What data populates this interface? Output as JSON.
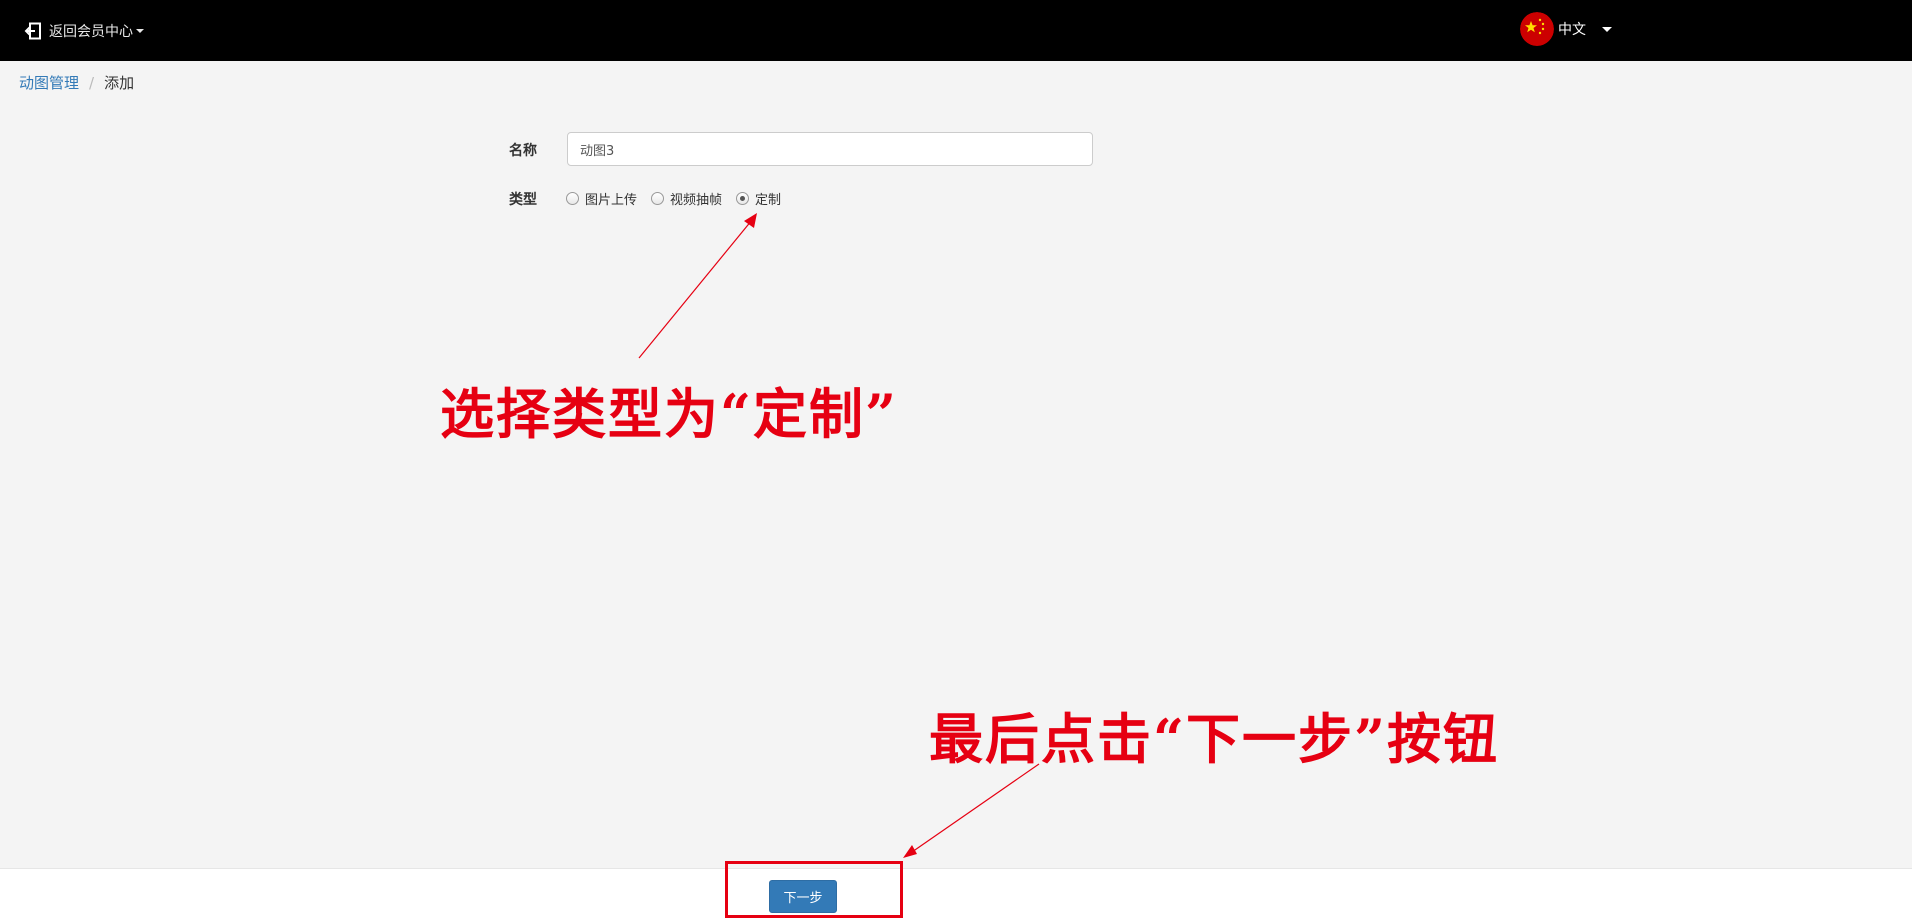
{
  "topbar": {
    "back_label": "返回会员中心",
    "language_label": "中文"
  },
  "breadcrumb": {
    "parent": "动图管理",
    "separator": "/",
    "current": "添加"
  },
  "form": {
    "name_label": "名称",
    "name_value": "动图3",
    "type_label": "类型",
    "type_options": [
      "图片上传",
      "视频抽帧",
      "定制"
    ],
    "type_selected": "定制"
  },
  "annotations": {
    "select_type": "选择类型为“定制”",
    "click_next": "最后点击“下一步”按钮"
  },
  "footer": {
    "next_label": "下一步"
  },
  "colors": {
    "topbar": "#000000",
    "accent": "#337ab7",
    "annotation_red": "#e60012",
    "background": "#f4f4f4"
  }
}
